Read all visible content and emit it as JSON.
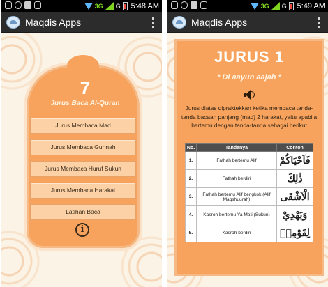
{
  "status_bar": {
    "network": "3G",
    "network2": "G",
    "time_left": "5:48",
    "time_right": "5:49",
    "ampm": "AM"
  },
  "app": {
    "title": "Maqdis Apps"
  },
  "menu": {
    "number": "7",
    "subtitle": "Jurus Baca Al-Quran",
    "items": [
      "Jurus Membaca Mad",
      "Jurus Membaca Gunnah",
      "Jurus Membaca Huruf Sukun",
      "Jurus Membaca Harakat",
      "Latihan Baca"
    ]
  },
  "detail": {
    "title": "JURUS 1",
    "subtitle": "* Di aayun aajah *",
    "description": "Jurus diatas dipraktekkan ketika membaca tanda-tanda bacaan panjang (mad) 2 harakat, yaitu apabila bertemu dengan tanda-tanda sebagai berikut",
    "table": {
      "headers": [
        "No.",
        "Tandanya",
        "Contoh"
      ],
      "rows": [
        {
          "no": "1.",
          "sign": "Fathah bertemu Alif",
          "example": "فَاَحْيَاكُمْ"
        },
        {
          "no": "2.",
          "sign": "Fathah berdiri",
          "example": "ذٰلِكَ"
        },
        {
          "no": "3.",
          "sign": "Fathah bertemu Alif bengkok (Alif Maqshuurah)",
          "example": "الْاَشْقَى"
        },
        {
          "no": "4.",
          "sign": "Kasroh bertemu Ya Mati (Sukun)",
          "example": "وَيَهْدِيْ"
        },
        {
          "no": "5.",
          "sign": "Kasroh berdiri",
          "example": "لِقَوْمِهٖ"
        }
      ]
    }
  },
  "icons": {
    "app": "app-logo-icon",
    "overflow": "overflow-menu-icon",
    "info": "info-icon",
    "speaker": "speaker-icon",
    "wifi": "wifi-icon",
    "signal": "signal-icon",
    "battery": "battery-icon"
  },
  "colors": {
    "accent": "#f7a35d",
    "button": "#fbd1a5",
    "action_bar": "#2c2c2c",
    "background": "#fbf3e6"
  }
}
